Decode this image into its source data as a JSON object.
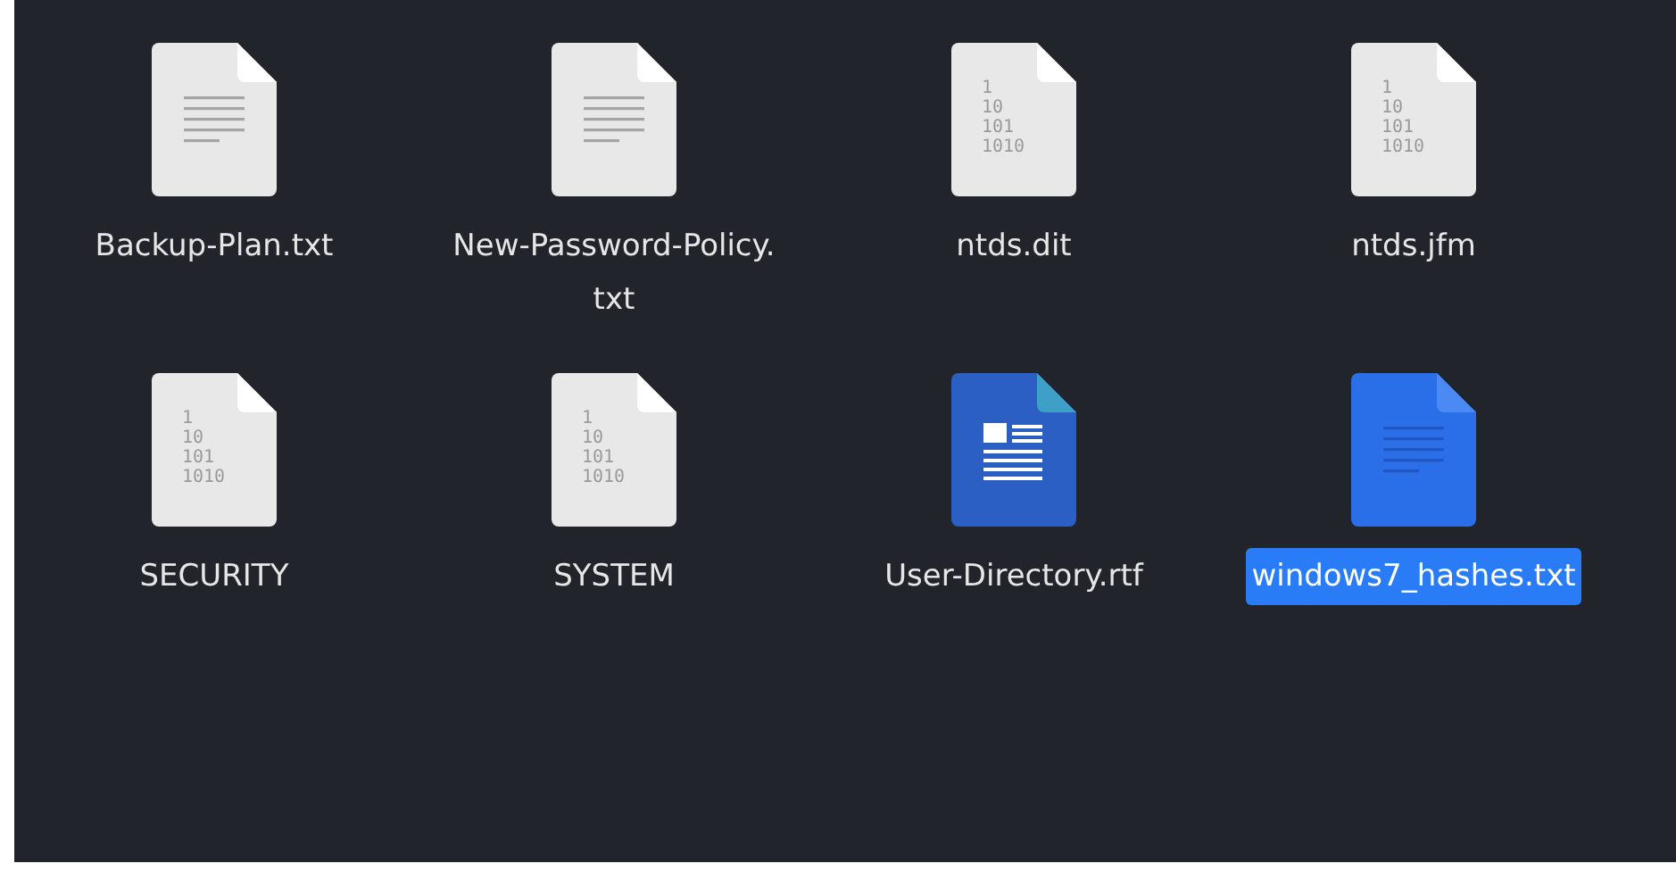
{
  "files": [
    {
      "name": "Backup-Plan.txt",
      "kind": "text",
      "selected": false
    },
    {
      "name": "New-Password-Policy.txt",
      "kind": "text",
      "selected": false
    },
    {
      "name": "ntds.dit",
      "kind": "binary",
      "icon_lines": [
        "1",
        "10",
        "101",
        "1010"
      ],
      "selected": false
    },
    {
      "name": "ntds.jfm",
      "kind": "binary",
      "icon_lines": [
        "1",
        "10",
        "101",
        "1010"
      ],
      "selected": false
    },
    {
      "name": "SECURITY",
      "kind": "binary",
      "icon_lines": [
        "1",
        "10",
        "101",
        "1010"
      ],
      "selected": false
    },
    {
      "name": "SYSTEM",
      "kind": "binary",
      "icon_lines": [
        "1",
        "10",
        "101",
        "1010"
      ],
      "selected": false
    },
    {
      "name": "User-Directory.rtf",
      "kind": "document",
      "selected": false
    },
    {
      "name": "windows7_hashes.txt",
      "kind": "text",
      "selected": true
    }
  ]
}
